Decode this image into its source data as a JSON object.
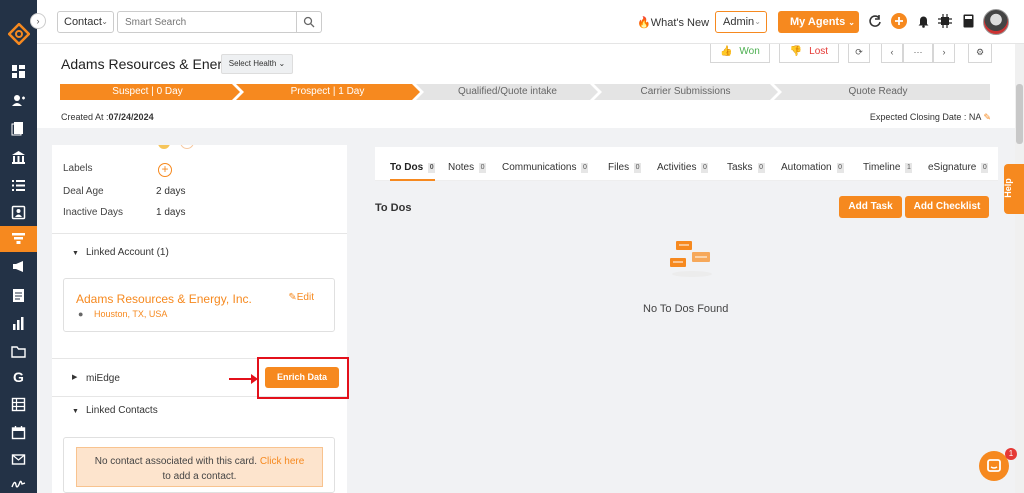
{
  "topbar": {
    "contact_select": "Contact",
    "search_placeholder": "Smart Search",
    "whats_new": "What's New",
    "admin_select": "Admin",
    "my_agents": "My Agents"
  },
  "record": {
    "title": "Adams Resources & Ener",
    "health_select": "Select Health",
    "won_label": "Won",
    "lost_label": "Lost",
    "more_label": "···",
    "created_label": "Created At :",
    "created_value": "07/24/2024",
    "closing_label": "Expected Closing Date :",
    "closing_value": "NA"
  },
  "pipeline": {
    "stages": [
      {
        "label": "Suspect | 0 Day",
        "state": "done"
      },
      {
        "label": "Prospect | 1 Day",
        "state": "done"
      },
      {
        "label": "Qualified/Quote intake",
        "state": "todo"
      },
      {
        "label": "Carrier Submissions",
        "state": "todo"
      },
      {
        "label": "Quote Ready",
        "state": "todo"
      }
    ]
  },
  "left": {
    "labels_label": "Labels",
    "deal_age_label": "Deal Age",
    "deal_age_value": "2 days",
    "inactive_days_label": "Inactive Days",
    "inactive_days_value": "1 days",
    "linked_account_title": "Linked Account (1)",
    "account_name": "Adams Resources & Energy, Inc.",
    "account_edit": "Edit",
    "account_location": "Houston, TX, USA",
    "miedge_title": "miEdge",
    "enrich_button": "Enrich Data",
    "linked_contacts_title": "Linked Contacts",
    "no_contact_text": "No contact associated with this card.",
    "no_contact_link": "Click here",
    "no_contact_suffix": "to add a contact."
  },
  "tabs": [
    {
      "label": "To Dos",
      "count": "0"
    },
    {
      "label": "Notes",
      "count": "0"
    },
    {
      "label": "Communications",
      "count": "0"
    },
    {
      "label": "Files",
      "count": "0"
    },
    {
      "label": "Activities",
      "count": "0"
    },
    {
      "label": "Tasks",
      "count": "0"
    },
    {
      "label": "Automation",
      "count": "0"
    },
    {
      "label": "Timeline",
      "count": "1"
    },
    {
      "label": "eSignature",
      "count": "0"
    }
  ],
  "todos": {
    "title": "To Dos",
    "add_task": "Add Task",
    "add_checklist": "Add Checklist",
    "empty_text": "No To Dos Found"
  },
  "help_label": "Help",
  "chat_badge": "1",
  "colors": {
    "accent": "#f6891f",
    "sidebar": "#233246",
    "highlight": "#e3101b"
  }
}
